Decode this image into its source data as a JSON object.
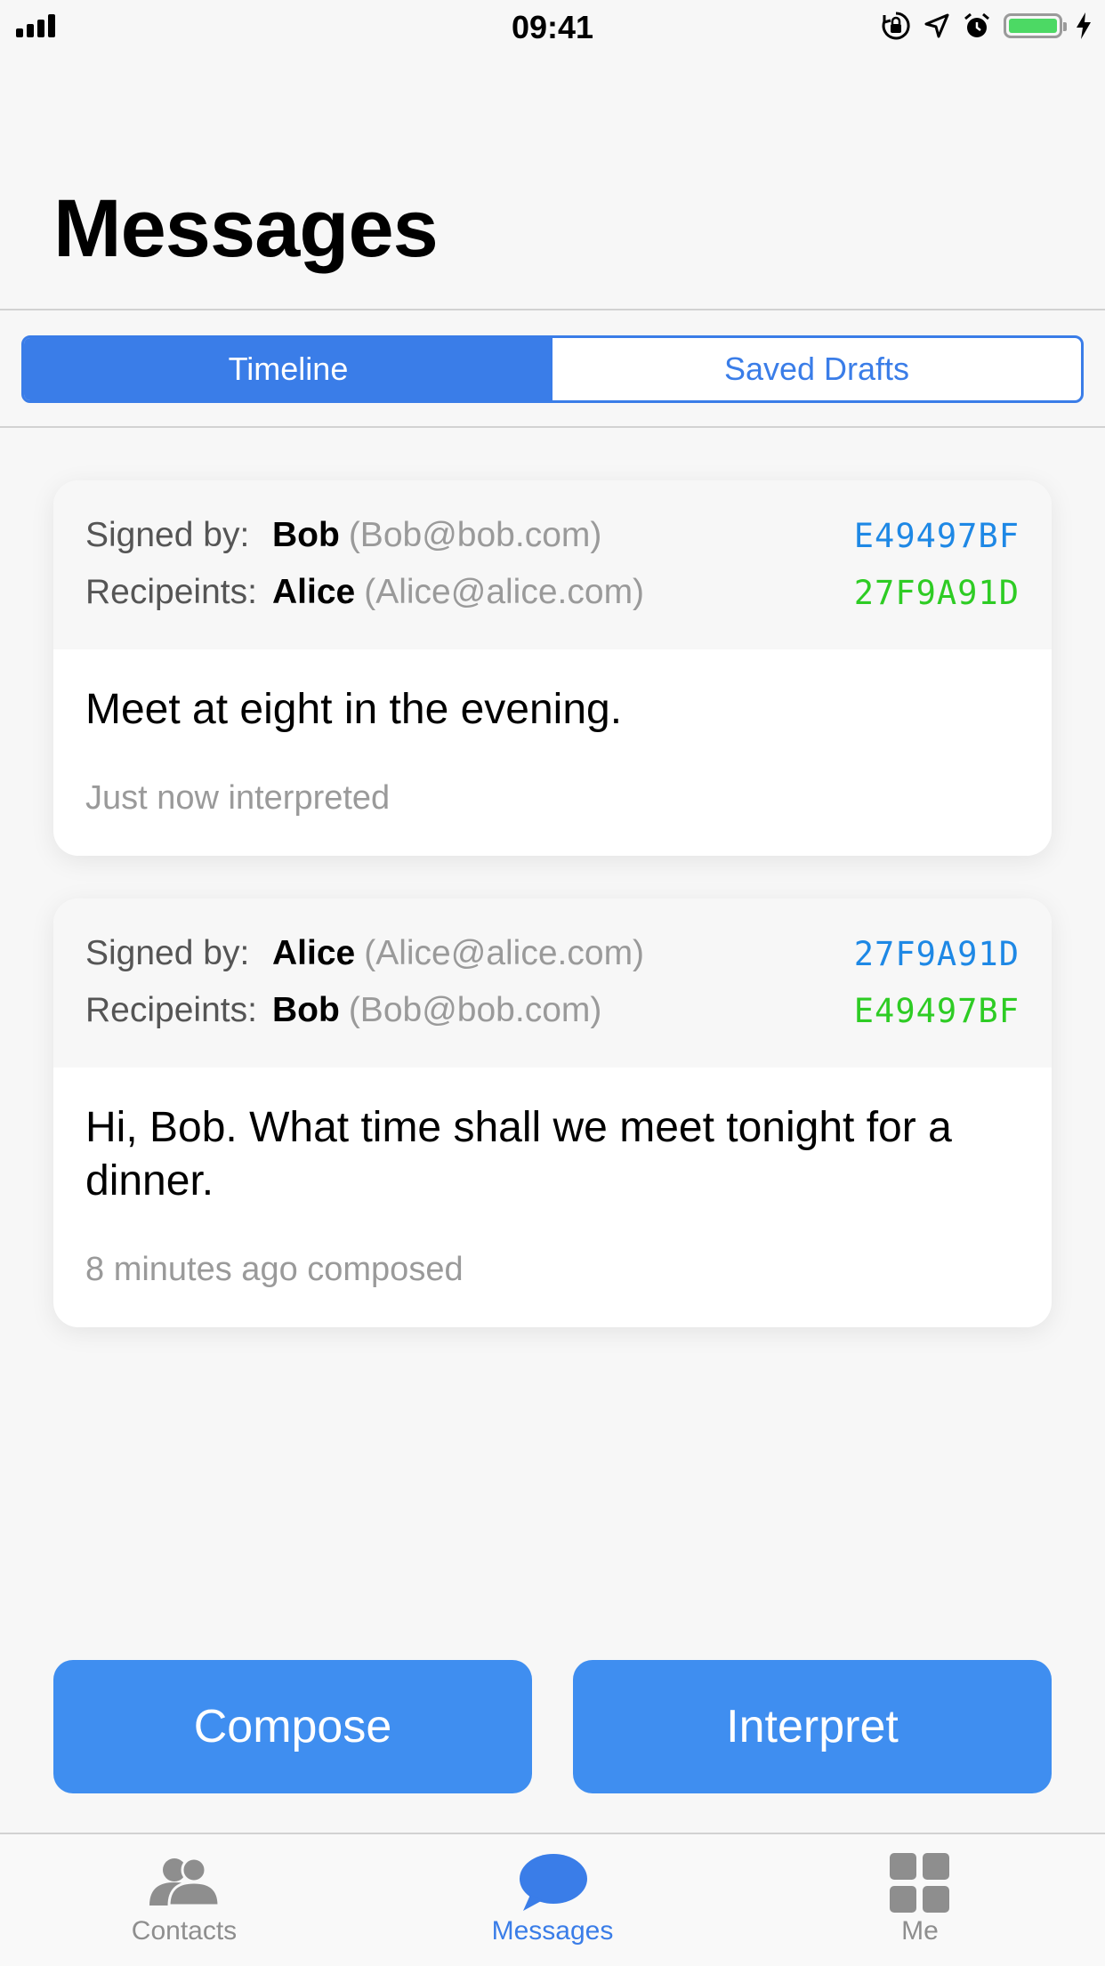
{
  "status_bar": {
    "time": "09:41"
  },
  "header": {
    "title": "Messages"
  },
  "segments": {
    "timeline": "Timeline",
    "drafts": "Saved Drafts"
  },
  "messages": [
    {
      "signed_label": "Signed by:",
      "signer_name": "Bob",
      "signer_email": "(Bob@bob.com)",
      "signer_key": "E49497BF",
      "recipients_label": "Recipeints:",
      "recipient_name": "Alice",
      "recipient_email": "(Alice@alice.com)",
      "recipient_key": "27F9A91D",
      "body": "Meet at eight in the evening.",
      "meta": "Just now interpreted"
    },
    {
      "signed_label": "Signed by:",
      "signer_name": "Alice",
      "signer_email": "(Alice@alice.com)",
      "signer_key": "27F9A91D",
      "recipients_label": "Recipeints:",
      "recipient_name": "Bob",
      "recipient_email": "(Bob@bob.com)",
      "recipient_key": "E49497BF",
      "body": "Hi, Bob. What time shall we meet tonight for a dinner.",
      "meta": "8 minutes ago composed"
    }
  ],
  "actions": {
    "compose": "Compose",
    "interpret": "Interpret"
  },
  "tabbar": {
    "contacts": "Contacts",
    "messages": "Messages",
    "me": "Me"
  },
  "colors": {
    "accent": "#3a7de8",
    "key_blue": "#1e88e5",
    "key_green": "#2ecc24",
    "battery": "#4cd964"
  },
  "icons": [
    "signal-icon",
    "rotation-lock-icon",
    "location-icon",
    "alarm-icon",
    "battery-icon",
    "charging-icon",
    "contacts-icon",
    "messages-icon",
    "grid-icon"
  ]
}
